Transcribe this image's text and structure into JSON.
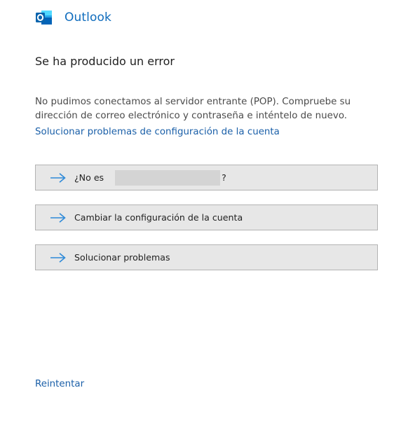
{
  "header": {
    "app_name": "Outlook",
    "logo_icon": "outlook-logo-icon"
  },
  "error": {
    "title": "Se ha producido un error",
    "message": "No pudimos conectamos al servidor entrante (POP). Compruebe su dirección de correo electrónico y contraseña e inténtelo de nuevo.",
    "troubleshoot_link": "Solucionar problemas de configuración de la cuenta"
  },
  "actions": [
    {
      "label_prefix": "¿No es",
      "label_suffix": "?",
      "icon": "arrow-right-icon"
    },
    {
      "label": "Cambiar la configuración de la cuenta",
      "icon": "arrow-right-icon"
    },
    {
      "label": "Solucionar problemas",
      "icon": "arrow-right-icon"
    }
  ],
  "footer": {
    "retry_label": "Reintentar"
  },
  "colors": {
    "brand": "#0f6cbd",
    "link": "#1a5fa8",
    "button_bg": "#e7e7e7",
    "button_border": "#b3b3b3",
    "arrow": "#2f8ad8"
  }
}
